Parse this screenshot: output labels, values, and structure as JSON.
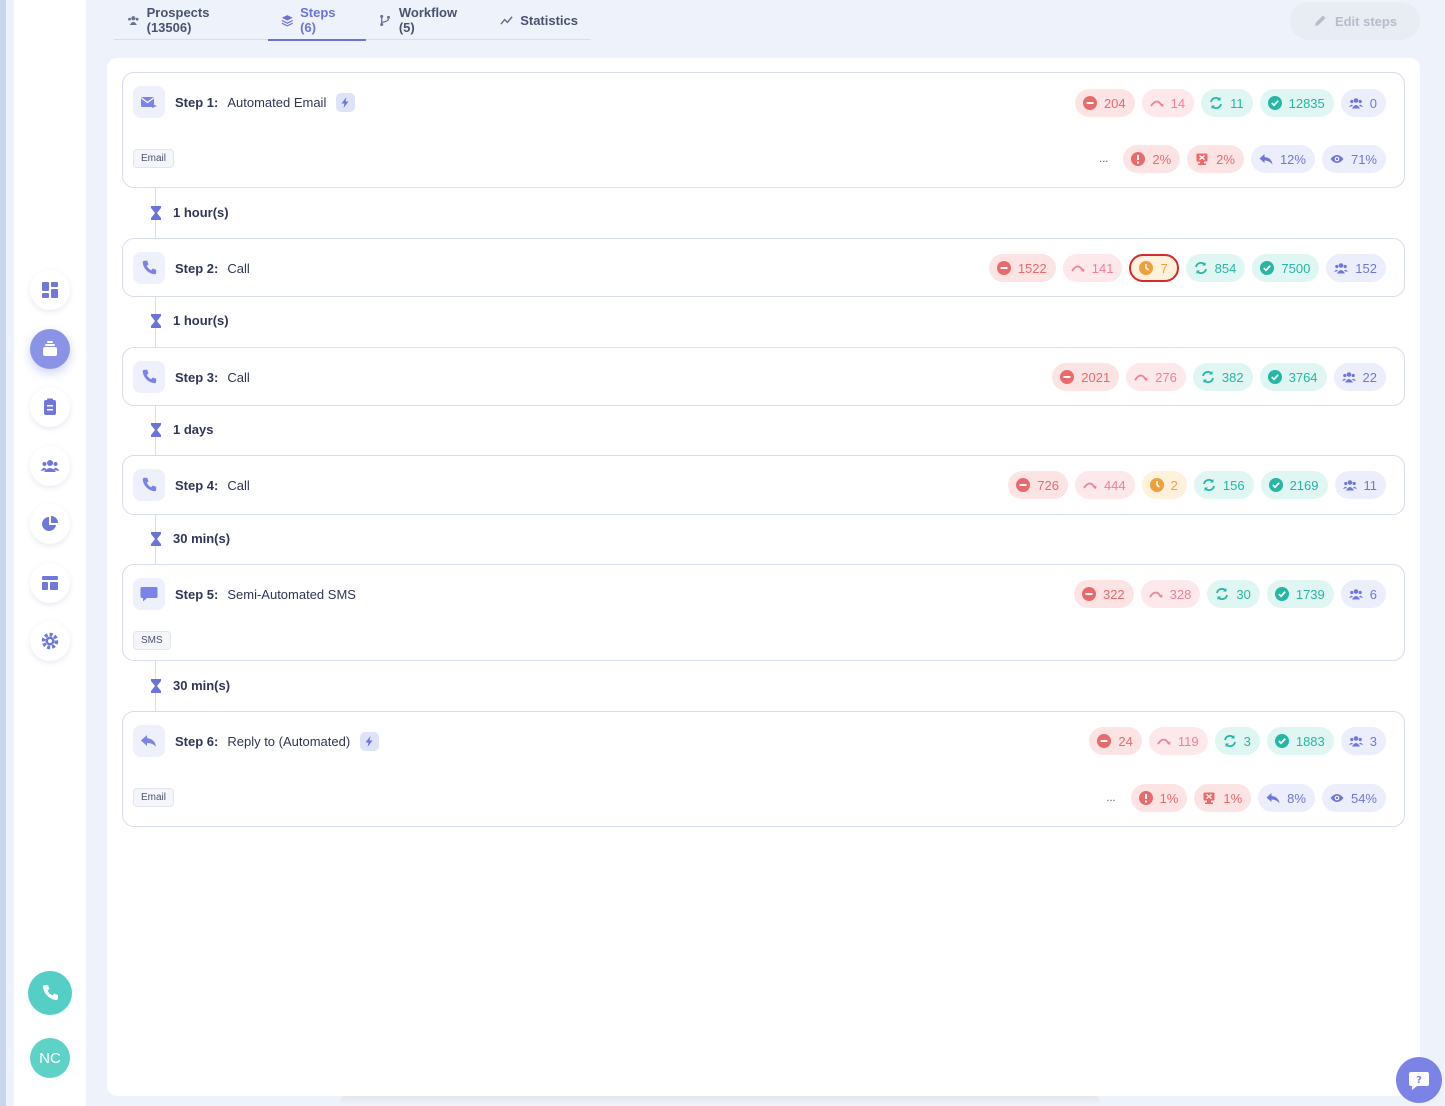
{
  "tabs": [
    {
      "label": "Prospects (13506)",
      "icon": "people-icon",
      "active": false
    },
    {
      "label": "Steps (6)",
      "icon": "layers-icon",
      "active": true
    },
    {
      "label": "Workflow (5)",
      "icon": "branch-icon",
      "active": false
    },
    {
      "label": "Statistics",
      "icon": "trend-icon",
      "active": false
    }
  ],
  "edit_button": "Edit steps",
  "sidebar": {
    "items": [
      "dashboard-icon",
      "sequences-icon",
      "tasks-icon",
      "contacts-icon",
      "reports-icon",
      "templates-icon",
      "settings-icon"
    ],
    "active_index": 1,
    "avatar_initials": "NC"
  },
  "steps": [
    {
      "num": "Step 1:",
      "name": "Automated Email",
      "icon": "email-send-icon",
      "auto": true,
      "channel": "Email",
      "stats": [
        "204",
        "14",
        "11",
        "12835",
        "0"
      ],
      "rates": [
        "...",
        "2%",
        "2%",
        "12%",
        "71%"
      ]
    },
    {
      "delay": "1 hour(s)"
    },
    {
      "num": "Step 2:",
      "name": "Call",
      "icon": "phone-icon",
      "stats": [
        "1522",
        "141",
        "7",
        "854",
        "7500",
        "152"
      ]
    },
    {
      "delay": "1 hour(s)"
    },
    {
      "num": "Step 3:",
      "name": "Call",
      "icon": "phone-icon",
      "stats": [
        "2021",
        "276",
        "382",
        "3764",
        "22"
      ]
    },
    {
      "delay": "1 days"
    },
    {
      "num": "Step 4:",
      "name": "Call",
      "icon": "phone-icon",
      "stats": [
        "726",
        "444",
        "2",
        "156",
        "2169",
        "11"
      ]
    },
    {
      "delay": "30 min(s)"
    },
    {
      "num": "Step 5:",
      "name": "Semi-Automated SMS",
      "icon": "sms-icon",
      "channel": "SMS",
      "stats": [
        "322",
        "328",
        "30",
        "1739",
        "6"
      ]
    },
    {
      "delay": "30 min(s)"
    },
    {
      "num": "Step 6:",
      "name": "Reply to (Automated)",
      "icon": "reply-icon",
      "auto": true,
      "channel": "Email",
      "stats": [
        "24",
        "119",
        "3",
        "1883",
        "3"
      ],
      "rates": [
        "...",
        "1%",
        "1%",
        "8%",
        "54%"
      ]
    }
  ],
  "colors": {
    "accent": "#6a73da",
    "red": "#e86a6a",
    "pink": "#ef8095",
    "orange": "#f0a03a",
    "teal": "#27b5a6",
    "indigo": "#6f78da",
    "highlight": "#d62a2a"
  }
}
